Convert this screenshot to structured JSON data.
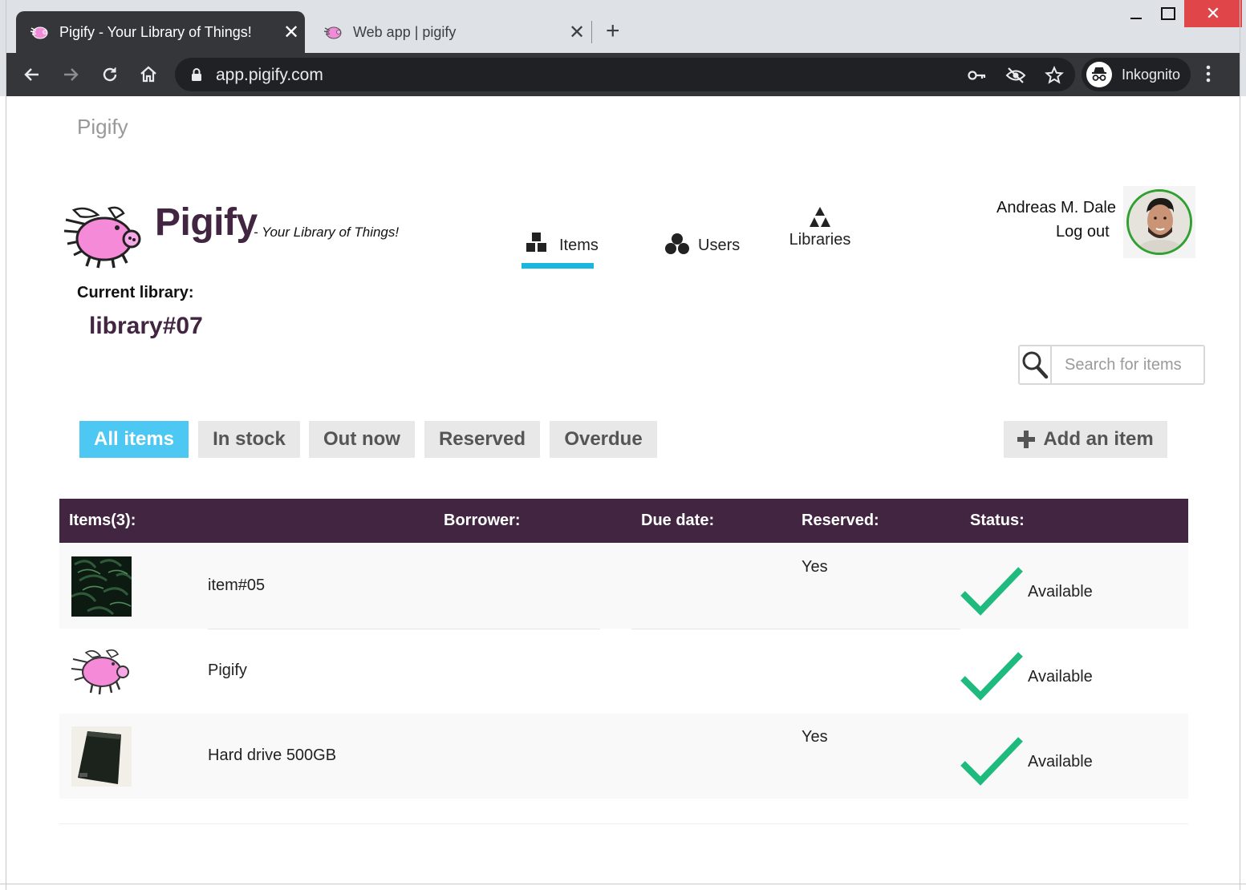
{
  "browser": {
    "tabs": [
      {
        "title": "Pigify - Your Library of Things!",
        "active": true
      },
      {
        "title": "Web app | pigify",
        "active": false
      }
    ],
    "url": "app.pigify.com",
    "profile_label": "Inkognito"
  },
  "site": {
    "brand_top": "Pigify",
    "logo_title": "Pigify",
    "logo_tagline": "- Your Library of Things!"
  },
  "nav": {
    "items": "Items",
    "users": "Users",
    "libraries": "Libraries",
    "active": "Items"
  },
  "user": {
    "name": "Andreas M. Dale",
    "logout": "Log out"
  },
  "library": {
    "label": "Current library:",
    "name": "library#07"
  },
  "search": {
    "placeholder": "Search for items"
  },
  "filters": {
    "all": "All items",
    "in_stock": "In stock",
    "out_now": "Out now",
    "reserved": "Reserved",
    "overdue": "Overdue",
    "active": "All items"
  },
  "add_item": "Add an item",
  "table": {
    "headers": {
      "items": "Items(3):",
      "borrower": "Borrower:",
      "due_date": "Due date:",
      "reserved": "Reserved:",
      "status": "Status:"
    },
    "rows": [
      {
        "name": "item#05",
        "borrower": "",
        "due_date": "",
        "reserved": "Yes",
        "status": "Available",
        "thumb": "dark-leaves-photo"
      },
      {
        "name": "Pigify",
        "borrower": "",
        "due_date": "",
        "reserved": "",
        "status": "Available",
        "thumb": "pigify-logo"
      },
      {
        "name": "Hard drive 500GB",
        "borrower": "",
        "due_date": "",
        "reserved": "Yes",
        "status": "Available",
        "thumb": "hard-drive-photo"
      }
    ]
  },
  "colors": {
    "brand": "#422541",
    "accent": "#4cc8f2",
    "nav_underline": "#19b6e0",
    "check": "#1fba7e"
  }
}
